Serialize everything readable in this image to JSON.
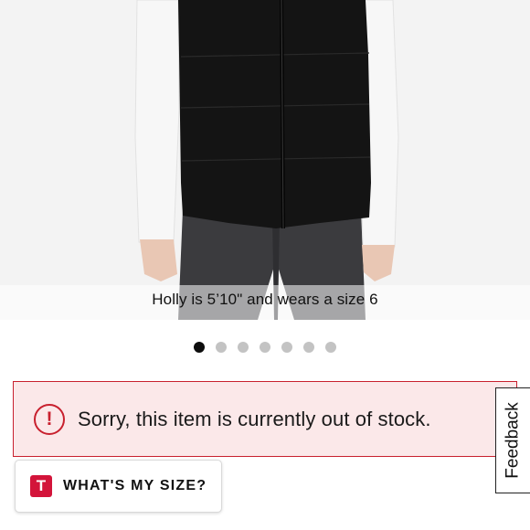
{
  "product": {
    "image_alt": "black puffer vest over white long-sleeve top and dark leggings",
    "model_caption": "Holly is 5’10\" and wears a size 6"
  },
  "carousel": {
    "total": 7,
    "active_index": 0
  },
  "stock_banner": {
    "icon": "alert-circle-icon",
    "message": "Sorry, this item is currently out of stock."
  },
  "size_button": {
    "badge": "T",
    "label": "WHAT'S MY SIZE?"
  },
  "feedback_tab": {
    "label": "Feedback"
  },
  "colors": {
    "alert_red": "#c8202e",
    "alert_bg": "#fbe8e9",
    "badge_red": "#d3143a",
    "dot_active": "#0d0d0d",
    "dot_inactive": "#c3c3c3"
  }
}
